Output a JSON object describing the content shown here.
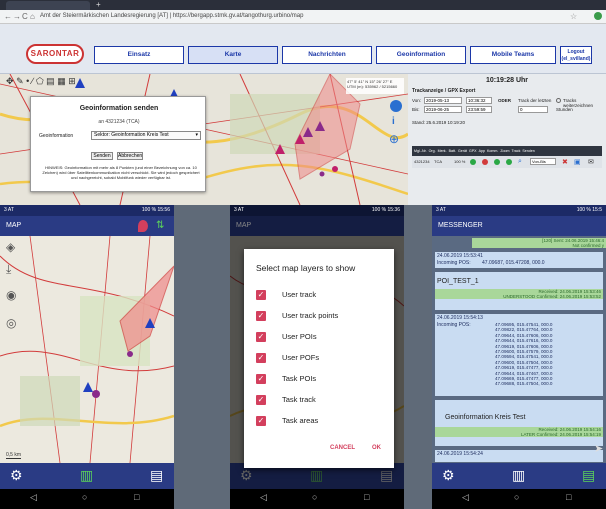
{
  "browser": {
    "tab_label": "",
    "url": "Amt der Steiermärkischen Landesregierung [AT] | https://bergapp.stmk.gv.at/tangothurg.urbino/map",
    "back_glyph": "←",
    "forward_glyph": "→",
    "reload_glyph": "C",
    "home_glyph": "⌂"
  },
  "app": {
    "logo_text": "SARONTAR",
    "nav": [
      "Einsatz",
      "Karte",
      "Nachrichten",
      "Geoinformation",
      "Mobile Teams"
    ],
    "logout": [
      "Logout",
      "(el_svilland)"
    ]
  },
  "geo_dialog": {
    "title": "Geoinformation senden",
    "to": "an 4321234 (TCA)",
    "field_label": "Geoinformation",
    "select_value": "Sektor: Geoinformation Kreis Test",
    "send": "Senden",
    "cancel": "Abbrechen",
    "note": "HINWEIS: Geoinformation mit mehr als 8 Punkten (und einer Bezeichnung von ca. 10 Zeichen) wird über Satellitenkommunikation nicht verschickt. Sie wird jedoch gespeichert und nachgereicht, sobald Mobilfunk wieder verfügbar ist."
  },
  "coords": {
    "line1": "47° 5' 41\" N 15° 26' 27\" E",
    "line2": "UTM (m): 535962 / 5215660"
  },
  "export": {
    "clock": "10:19:28 Uhr",
    "title": "Trackanzeige / GPX Export",
    "von_label": "Von:",
    "von_date": "2019-05-13",
    "von_time": "10:36:32",
    "oder": "ODER",
    "track_der_letzten": "Track der letzten",
    "track_weiterzeichnen": "Tracks weiterzeichnen",
    "bis_label": "Bis:",
    "bis_date": "2019-06-25",
    "bis_time": "23:59:59",
    "hours_value": "0",
    "stunden": "Stunden",
    "stand": "Stand: 25.6.2019 10:19:20",
    "table_headers": [
      "Mgl.-Nr.",
      "Org.",
      "Merk.",
      "Batt.",
      "Gerät",
      "GPX",
      "App",
      "Komm.",
      "Zoom",
      "Track",
      "Senden"
    ],
    "row_id": "4321234",
    "row_org": "TCA",
    "row_batt": "100 %",
    "track_select": "Von-Bis"
  },
  "phone1": {
    "status_left": "3 AT",
    "status_right": "100 % 15:56",
    "title": "MAP",
    "scale": "0,5 km"
  },
  "phone2": {
    "status_left": "3 AT",
    "status_right": "100 % 15:36",
    "title": "MAP",
    "dialog_title": "Select map layers to show",
    "layers": [
      "User track",
      "User track points",
      "User POIs",
      "User POFs",
      "Task POIs",
      "Task track",
      "Task areas"
    ],
    "cancel": "CANCEL",
    "ok": "OK"
  },
  "phone3": {
    "status_left": "3 AT",
    "status_right": "100 % 15:5",
    "title": "MESSENGER",
    "top_line1": "[120]  Sent: 24.06.2019 15:46:4",
    "top_line2": "Not confirmed y",
    "msg1": {
      "ts": "24.06.2019 15:53:41",
      "label": "Incoming POS:",
      "pos": "47.09687, 015.47208, 000.0"
    },
    "msg2": {
      "title": "POI_TEST_1",
      "received": "Received: 24.06.2019 15:53:46",
      "confirmed_label": "UNDERSTOOD",
      "confirmed": "Confirmed: 24.06.2019 15:53:52"
    },
    "msg3": {
      "ts": "24.06.2019 15:54:13",
      "label": "Incoming POS:",
      "points": [
        "47.09695, 015.47541, 000.0",
        "47.09822, 015.47764, 000.0",
        "47.09644, 015.47606, 000.0",
        "47.09644, 015.47616, 000.0",
        "47.09619, 015.47606, 000.0",
        "47.09600, 015.47579, 000.0",
        "47.09594, 015.47541, 000.0",
        "47.09600, 015.47504, 000.0",
        "47.09619, 015.47477, 000.0",
        "47.09644, 015.47467, 000.0",
        "47.09669, 015.47477, 000.0",
        "47.09688, 015.47504, 000.0"
      ]
    },
    "msg4": {
      "title": "Geoinformation Kreis Test",
      "received": "Received: 24.06.2019 15:54:16",
      "confirmed_label": "LATER",
      "confirmed": "Confirmed: 24.06.2019 15:54:19"
    },
    "msg5_ts": "24.06.2019 15:54:24"
  },
  "android_nav": {
    "back": "◁",
    "home": "○",
    "recents": "□"
  },
  "colors": {
    "accent": "#d33f5d",
    "appbar": "#2a3b84",
    "nav_border": "#1c38a8"
  }
}
